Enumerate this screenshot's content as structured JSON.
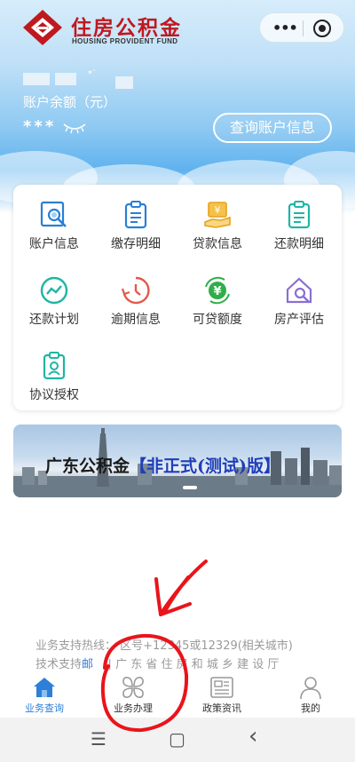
{
  "header": {
    "logo_title": "住房公积金",
    "logo_subtitle": "HOUSING PROVIDENT FUND",
    "capsule_more": "•••",
    "brand_color": "#c0181f"
  },
  "account": {
    "name_hint": "*`",
    "balance_label": "账户余额（元）",
    "balance_value": "***",
    "query_button": "查询账户信息"
  },
  "services": [
    {
      "label": "账户信息",
      "icon": "account-search-icon",
      "color": "#2a7fd4"
    },
    {
      "label": "缴存明细",
      "icon": "clipboard-list-icon",
      "color": "#2a7fd4"
    },
    {
      "label": "贷款信息",
      "icon": "yuan-hand-icon",
      "color": "#e8a21a"
    },
    {
      "label": "还款明细",
      "icon": "clipboard-list-icon",
      "color": "#1fb5a5"
    },
    {
      "label": "还款计划",
      "icon": "trend-chart-icon",
      "color": "#1fb5a5"
    },
    {
      "label": "逾期信息",
      "icon": "clock-alert-icon",
      "color": "#e05a4a"
    },
    {
      "label": "可贷额度",
      "icon": "yuan-cycle-icon",
      "color": "#2fae4a"
    },
    {
      "label": "房产评估",
      "icon": "house-search-icon",
      "color": "#8a6fd4"
    },
    {
      "label": "协议授权",
      "icon": "badge-clipboard-icon",
      "color": "#1fb5a5"
    }
  ],
  "banner": {
    "title_main": "广东公积金",
    "title_tag": "【非正式(测试)版】"
  },
  "footer": {
    "hotline": "业务支持热线：  区号+12345或12329(相关城市)",
    "tech_prefix": "技术支持",
    "tech_highlight": "邮   ",
    "tech_rest": "  |  广 东 省 住 房 和 城 乡 建 设 厅"
  },
  "tabs": [
    {
      "label": "业务查询",
      "icon": "home-icon",
      "active": true
    },
    {
      "label": "业务办理",
      "icon": "four-leaf-icon",
      "active": false
    },
    {
      "label": "政策资讯",
      "icon": "newspaper-icon",
      "active": false
    },
    {
      "label": "我的",
      "icon": "person-icon",
      "active": false
    }
  ],
  "system_nav": {
    "menu": "☰",
    "home": "▢",
    "back": "‹"
  },
  "colors": {
    "accent": "#2e7fd8",
    "annotation": "#e8151b"
  }
}
